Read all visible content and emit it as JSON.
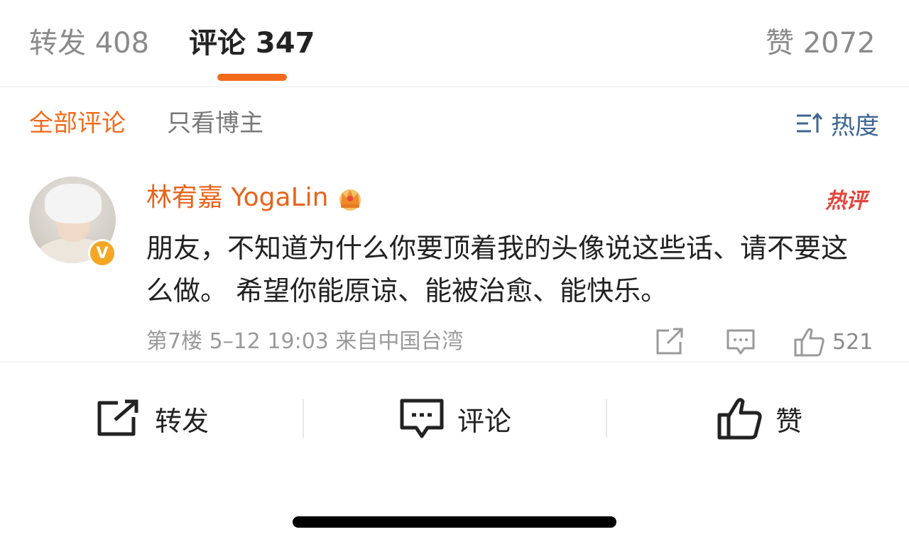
{
  "tabs": {
    "repost": "转发 408",
    "comments": "评论 347",
    "likes": "赞 2072"
  },
  "filters": {
    "all": "全部评论",
    "owner_only": "只看博主",
    "sort": "热度",
    "sort_icon": "sort-icon"
  },
  "comment": {
    "user": "林宥嘉 YogaLin",
    "verified_badge": "V",
    "crown_icon": "crown-icon",
    "hot_tag": "热评",
    "text": "朋友，不知道为什么你要顶着我的头像说这些话、请不要这么做。 希望你能原谅、能被治愈、能快乐。",
    "meta": "第7楼 5–12 19:03 来自中国台湾",
    "like_count": "521"
  },
  "actions": {
    "repost": "转发",
    "comment": "评论",
    "like": "赞"
  },
  "colors": {
    "accent": "#f26b1d",
    "username": "#e8641a",
    "hot": "#e2463d",
    "link_blue": "#3d6592"
  }
}
